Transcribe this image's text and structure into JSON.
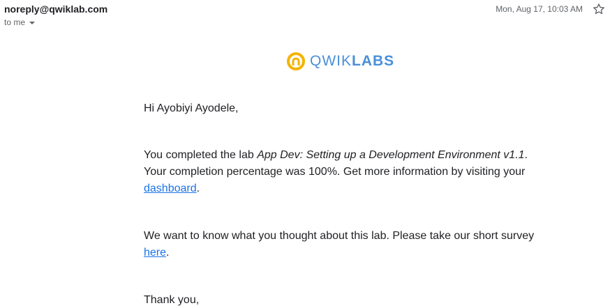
{
  "header": {
    "sender": "noreply@qwiklab.com",
    "recipient_label": "to me",
    "timestamp": "Mon, Aug 17, 10:03 AM",
    "star_icon": "star-outline-icon"
  },
  "logo": {
    "text_light": "QWIK",
    "text_bold": "LABS",
    "ring_color": "#f4b400",
    "text_color": "#4a90d9"
  },
  "message": {
    "greeting": "Hi Ayobiyi Ayodele,",
    "para1_prefix": "You completed the lab ",
    "lab_name": "App Dev: Setting up a Development Environment v1.1",
    "para1_mid": ". Your completion percentage was 100%. Get more information by visiting your ",
    "dashboard_link": "dashboard",
    "para1_suffix": ".",
    "para2_prefix": "We want to know what you thought about this lab. Please take our short survey ",
    "survey_link": "here",
    "para2_suffix": ".",
    "closing": "Thank you,"
  }
}
